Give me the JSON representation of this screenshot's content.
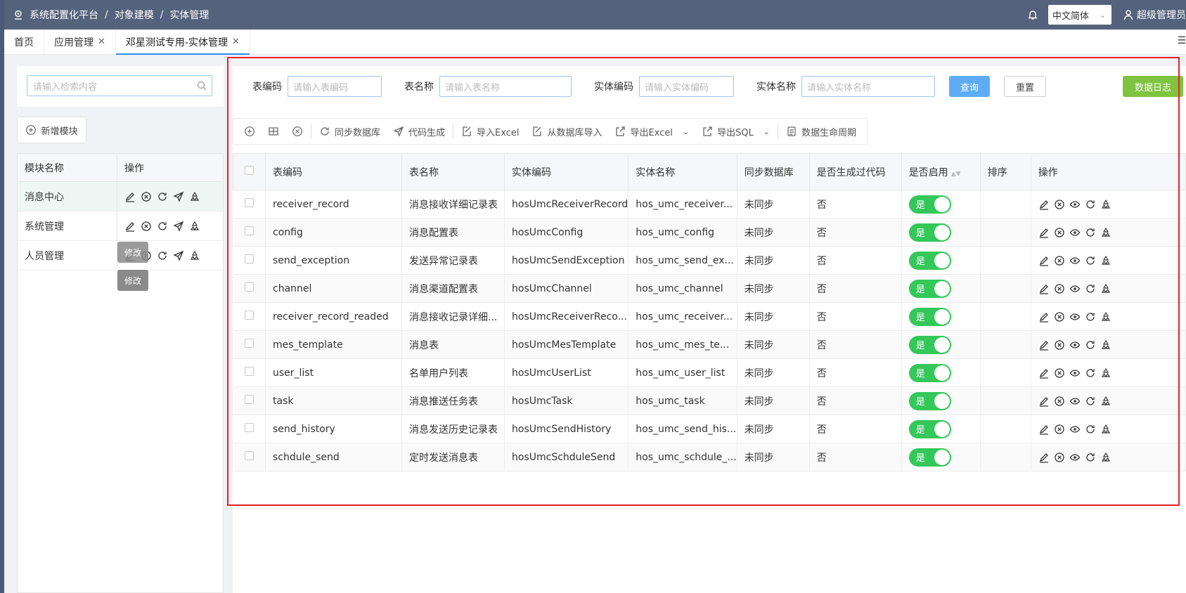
{
  "header": {
    "breadcrumb": [
      "系统配置化平台",
      "对象建模",
      "实体管理"
    ],
    "language": "中文简体",
    "user": "超级管理员"
  },
  "tabs": [
    {
      "label": "首页",
      "closable": false
    },
    {
      "label": "应用管理",
      "closable": true
    },
    {
      "label": "邓星测试专用-实体管理",
      "closable": true,
      "active": true
    }
  ],
  "sidebar": {
    "search_placeholder": "请输入检索内容",
    "add_module_label": "新增模块",
    "col_name": "模块名称",
    "col_ops": "操作",
    "modules": [
      "消息中心",
      "系统管理",
      "人员管理"
    ],
    "tooltip_behind": "修改",
    "tooltip": "修改"
  },
  "filters": {
    "table_code_label": "表编码",
    "table_code_placeholder": "请输入表编码",
    "table_name_label": "表名称",
    "table_name_placeholder": "请输入表名称",
    "entity_code_label": "实体编码",
    "entity_code_placeholder": "请输入实体编码",
    "entity_name_label": "实体名称",
    "entity_name_placeholder": "请输入实体名称",
    "query_button": "查询",
    "reset_button": "重置",
    "data_log_button": "数据日志"
  },
  "toolbar": {
    "sync_db": "同步数据库",
    "code_gen": "代码生成",
    "import_excel": "导入Excel",
    "import_db": "从数据库导入",
    "export_excel": "导出Excel",
    "export_sql": "导出SQL",
    "lifecycle": "数据生命周期"
  },
  "table": {
    "columns": [
      "表编码",
      "表名称",
      "实体编码",
      "实体名称",
      "同步数据库",
      "是否生成过代码",
      "是否启用",
      "排序",
      "操作"
    ],
    "rows": [
      {
        "code": "receiver_record",
        "name": "消息接收详细记录表",
        "entity_code": "hosUmcReceiverRecord",
        "entity_name": "hos_umc_receiver...",
        "sync": "未同步",
        "generated": "否",
        "enabled": "是"
      },
      {
        "code": "config",
        "name": "消息配置表",
        "entity_code": "hosUmcConfig",
        "entity_name": "hos_umc_config",
        "sync": "未同步",
        "generated": "否",
        "enabled": "是"
      },
      {
        "code": "send_exception",
        "name": "发送异常记录表",
        "entity_code": "hosUmcSendException",
        "entity_name": "hos_umc_send_ex...",
        "sync": "未同步",
        "generated": "否",
        "enabled": "是"
      },
      {
        "code": "channel",
        "name": "消息渠道配置表",
        "entity_code": "hosUmcChannel",
        "entity_name": "hos_umc_channel",
        "sync": "未同步",
        "generated": "否",
        "enabled": "是"
      },
      {
        "code": "receiver_record_readed",
        "name": "消息接收记录详细...",
        "entity_code": "hosUmcReceiverReco...",
        "entity_name": "hos_umc_receiver...",
        "sync": "未同步",
        "generated": "否",
        "enabled": "是"
      },
      {
        "code": "mes_template",
        "name": "消息表",
        "entity_code": "hosUmcMesTemplate",
        "entity_name": "hos_umc_mes_te...",
        "sync": "未同步",
        "generated": "否",
        "enabled": "是"
      },
      {
        "code": "user_list",
        "name": "名单用户列表",
        "entity_code": "hosUmcUserList",
        "entity_name": "hos_umc_user_list",
        "sync": "未同步",
        "generated": "否",
        "enabled": "是"
      },
      {
        "code": "task",
        "name": "消息推送任务表",
        "entity_code": "hosUmcTask",
        "entity_name": "hos_umc_task",
        "sync": "未同步",
        "generated": "否",
        "enabled": "是"
      },
      {
        "code": "send_history",
        "name": "消息发送历史记录表",
        "entity_code": "hosUmcSendHistory",
        "entity_name": "hos_umc_send_his...",
        "sync": "未同步",
        "generated": "否",
        "enabled": "是"
      },
      {
        "code": "schdule_send",
        "name": "定时发送消息表",
        "entity_code": "hosUmcSchduleSend",
        "entity_name": "hos_umc_schdule_...",
        "sync": "未同步",
        "generated": "否",
        "enabled": "是"
      }
    ]
  }
}
